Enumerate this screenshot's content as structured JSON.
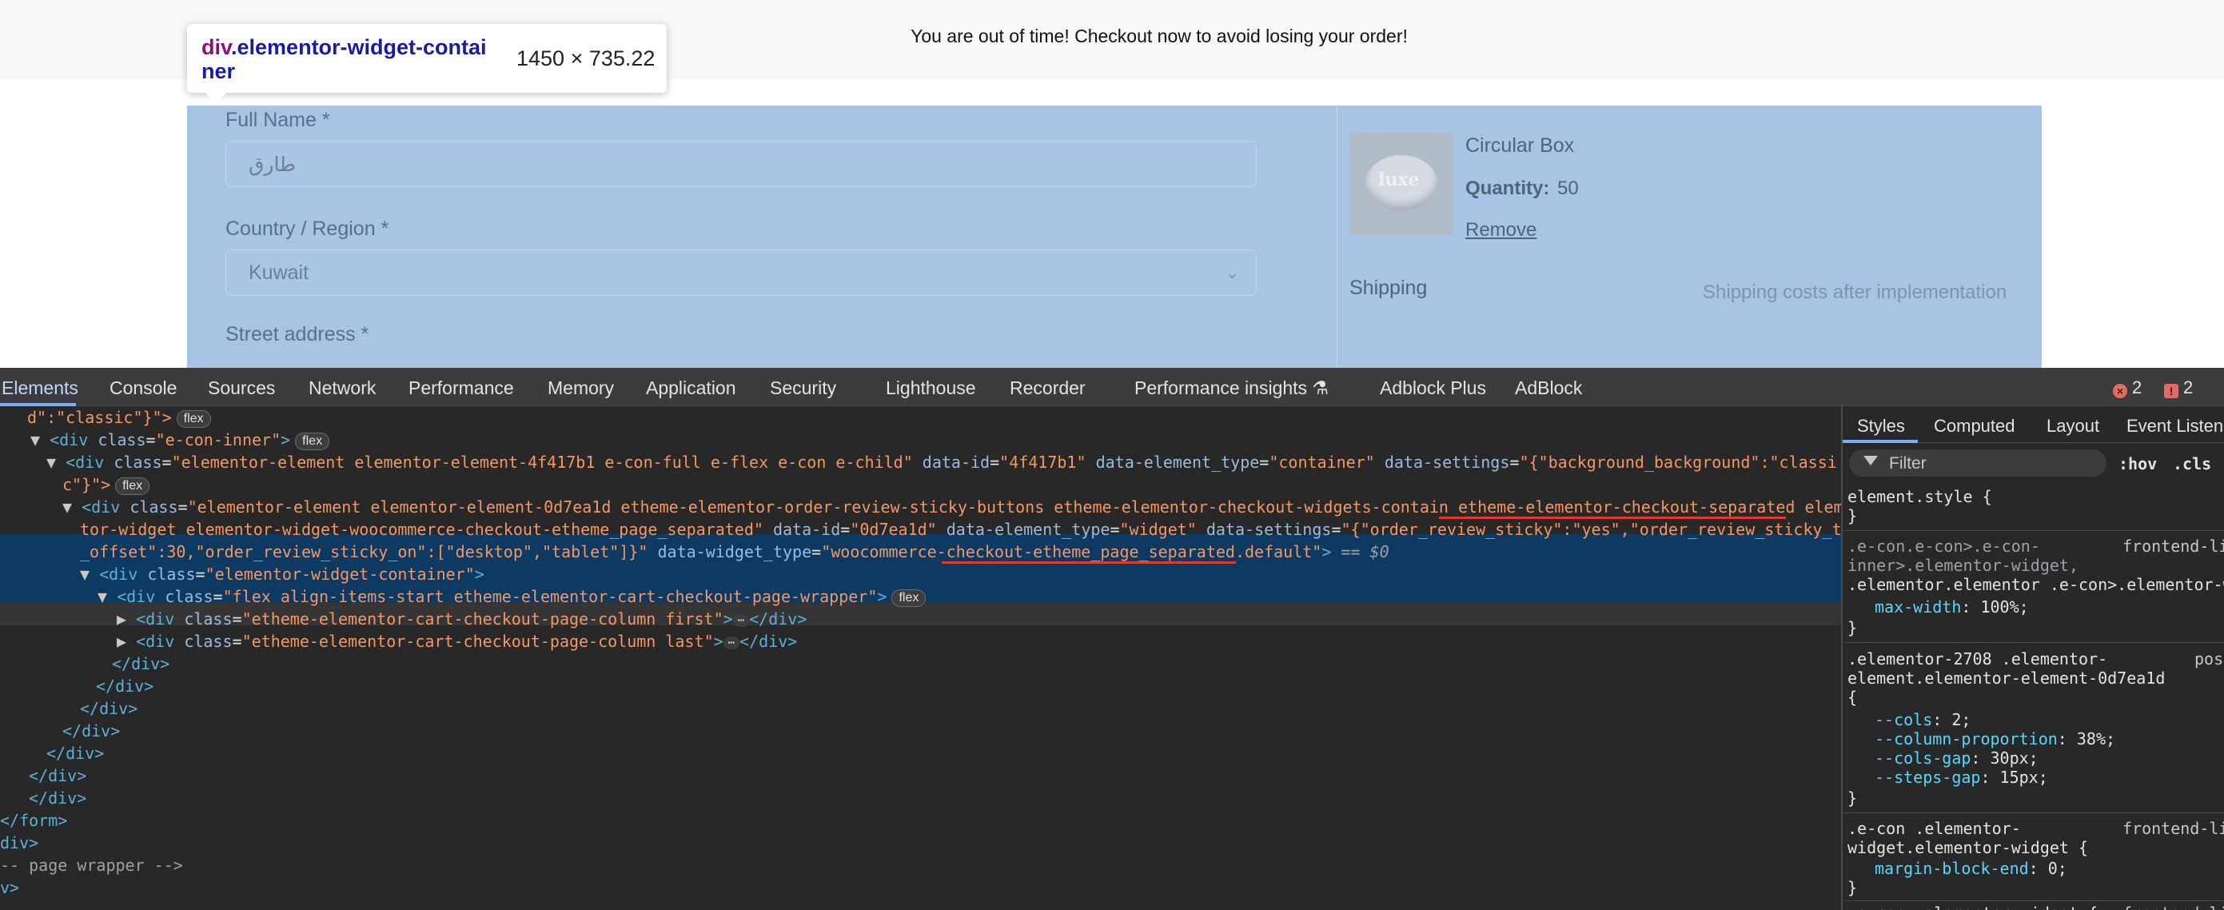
{
  "page": {
    "banner_text": "You are out of time! Checkout now to avoid losing your order!",
    "tooltip": {
      "tag": "div",
      "class_part1": ".elementor-widget-contai",
      "class_part2": "ner",
      "size": "1450 × 735.22"
    },
    "form": {
      "full_name_label": "Full Name *",
      "full_name_value": "طارق",
      "country_label": "Country / Region *",
      "country_value": "Kuwait",
      "street_label": "Street address *"
    },
    "product": {
      "name": "Circular Box",
      "logo_text": "luxe",
      "quantity_label": "Quantity:",
      "quantity_value": "50",
      "remove_label": "Remove",
      "shipping_label": "Shipping",
      "shipping_value": "Shipping costs after implementation"
    }
  },
  "devtools": {
    "tabs": [
      "Elements",
      "Console",
      "Sources",
      "Network",
      "Performance",
      "Memory",
      "Application",
      "Security",
      "Lighthouse",
      "Recorder",
      "Performance insights ⚗",
      "Adblock Plus",
      "AdBlock"
    ],
    "errors_count": "2",
    "issues_count": "2",
    "dom": {
      "l0": "d\":\"classic\"}\">",
      "l1_class": "e-con-inner",
      "l2_class": "elementor-element elementor-element-4f417b1 e-con-full e-flex e-con e-child",
      "l2_dataid": "4f417b1",
      "l2_type": "container",
      "l2_settings": "{\"background_background\":\"classi",
      "l2b": "c\"}\">",
      "l3_class_a": "elementor-element elementor-element-0d7ea1d etheme-elementor-order-review-sticky-buttons etheme-elementor-checkout-widgets-contain etheme-elementor-checkout-separated elemen",
      "l3_class_b": "tor-widget elementor-widget-woocommerce-checkout-etheme_page_separated",
      "l3_dataid": "0d7ea1d",
      "l3_type": "widget",
      "l3_settings": "{\"order_review_sticky\":\"yes\",\"order_review_sticky_top",
      "l3c_settings": "_offset\":30,\"order_review_sticky_on\":[\"desktop\",\"tablet\"]}",
      "l3c_widget_type": "woocommerce-checkout-etheme_page_separated.default",
      "l3c_tail": " == $0",
      "l4_class": "elementor-widget-container",
      "l5_class": "flex align-items-start etheme-elementor-cart-checkout-page-wrapper",
      "l6_class": "etheme-elementor-cart-checkout-page-column first",
      "l7_class": "etheme-elementor-cart-checkout-page-column last",
      "badge_flex": "flex",
      "ellipsis": "⋯",
      "comment": "-- page wrapper -->",
      "close_div": "</div>",
      "close_form": "</form>",
      "frag_div": "div>",
      "frag_v": "v>"
    },
    "styles": {
      "tabs": [
        "Styles",
        "Computed",
        "Layout",
        "Event Listen"
      ],
      "filter_placeholder": "Filter",
      "hov": ":hov",
      "cls": ".cls",
      "r0_selector": "element.style {",
      "r1_sel1": ".e-con.e-con>.e-con-",
      "r1_sel2": "inner>.elementor-widget,",
      "r1_sel3": ".elementor.elementor .e-con>.elementor-w",
      "r1_src": "frontend-li",
      "r1_prop": "max-width",
      "r1_val": "100%;",
      "r2_sel1": ".elementor-2708 .elementor-",
      "r2_sel2": "element.elementor-element-0d7ea1d",
      "r2_src": "pos",
      "r2_p1": "--cols",
      "r2_v1": "2;",
      "r2_p2": "--column-proportion",
      "r2_v2": "38%;",
      "r2_p3": "--cols-gap",
      "r2_v3": "30px;",
      "r2_p4": "--steps-gap",
      "r2_v4": "15px;",
      "r3_sel1": ".e-con .elementor-",
      "r3_sel2": "widget.elementor-widget {",
      "r3_src": "frontend-li",
      "r3_prop": "margin-block-end",
      "r3_val": "0;",
      "r4_sel": ".e-con .elementor-widget {",
      "r4_src": "frontend-li"
    }
  }
}
